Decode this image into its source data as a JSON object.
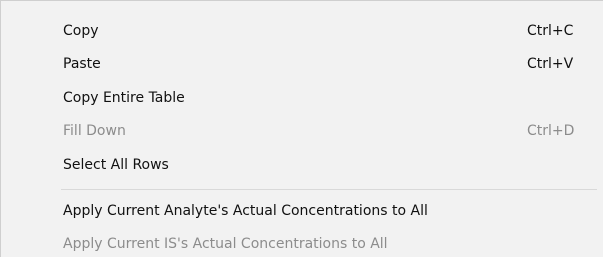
{
  "menu": {
    "items": [
      {
        "label": "Copy",
        "shortcut": "Ctrl+C",
        "enabled": true
      },
      {
        "label": "Paste",
        "shortcut": "Ctrl+V",
        "enabled": true
      },
      {
        "label": "Copy Entire Table",
        "shortcut": "",
        "enabled": true
      },
      {
        "label": "Fill Down",
        "shortcut": "Ctrl+D",
        "enabled": false
      },
      {
        "label": "Select All Rows",
        "shortcut": "",
        "enabled": true
      },
      {
        "label": "Apply Current Analyte's Actual Concentrations to All",
        "shortcut": "",
        "enabled": true
      },
      {
        "label": "Apply Current IS's Actual Concentrations to All",
        "shortcut": "",
        "enabled": false
      }
    ]
  }
}
